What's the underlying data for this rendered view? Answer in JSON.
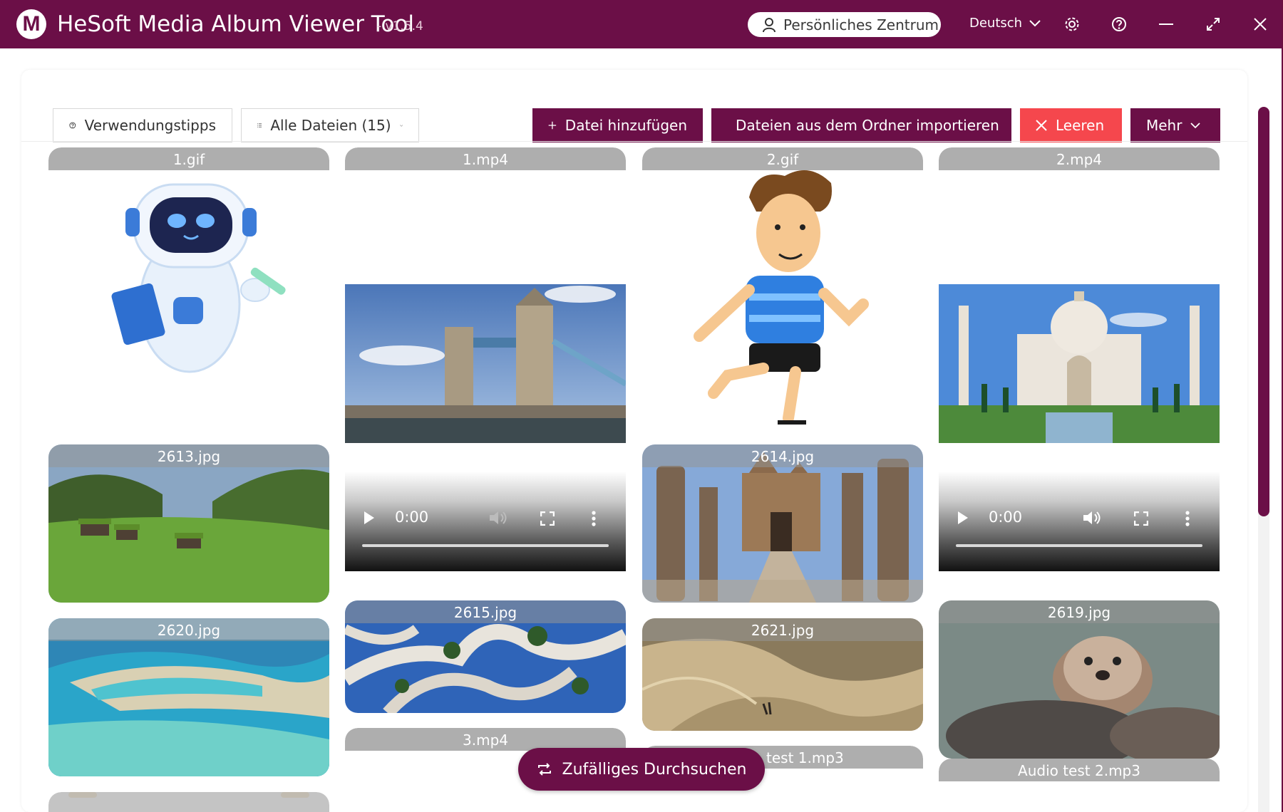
{
  "app": {
    "logo_letter": "M",
    "title": "HeSoft Media Album Viewer Tool",
    "version": "- v1.5.4",
    "personal_center": "Persönliches Zentrum",
    "language": "Deutsch"
  },
  "toolbar": {
    "tips": "Verwendungstipps",
    "filter": "Alle Dateien (15)",
    "add_file": "Datei hinzufügen",
    "import_folder": "Dateien aus dem Ordner importieren",
    "clear": "Leeren",
    "more": "Mehr"
  },
  "gallery": {
    "tiles": [
      {
        "name": "1.gif"
      },
      {
        "name": "1.mp4",
        "time": "0:00"
      },
      {
        "name": "2.gif"
      },
      {
        "name": "2.mp4",
        "time": "0:00"
      },
      {
        "name": "2613.jpg"
      },
      {
        "name": "2614.jpg"
      },
      {
        "name": "2615.jpg"
      },
      {
        "name": "2619.jpg"
      },
      {
        "name": "2620.jpg"
      },
      {
        "name": "2621.jpg"
      },
      {
        "name": "3.mp4"
      },
      {
        "name": "Audio test 1.mp3",
        "visible_text": "test 1.mp3"
      },
      {
        "name": "Audio test 2.mp3"
      }
    ]
  },
  "random_browse": "Zufälliges Durchsuchen",
  "colors": {
    "brand": "#6b0f47",
    "danger": "#f5474d",
    "label_bg": "#a0a0a0"
  }
}
